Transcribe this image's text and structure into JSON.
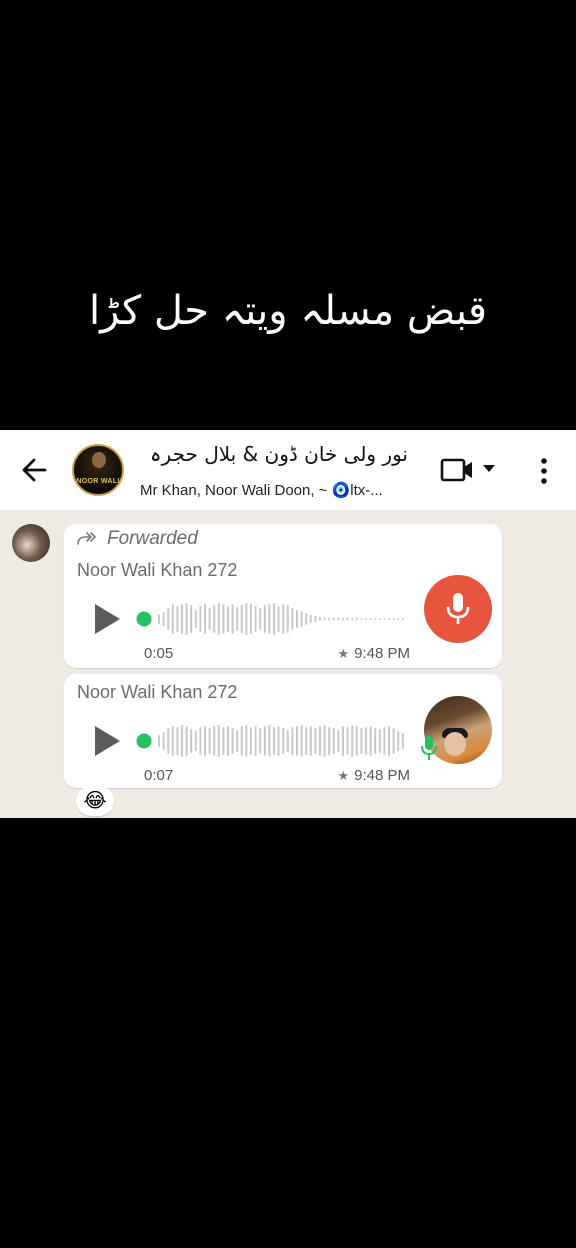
{
  "caption": "قبض مسلہ ویتہ حل کڑا",
  "header": {
    "title": "نور ولی خان ڈون & بلال حجرہ",
    "subtitle": "Mr Khan, Noor Wali Doon, ~ 🧿ltx-...",
    "avatar_text": "NOOR WALI"
  },
  "messages": [
    {
      "forwarded_label": "Forwarded",
      "sender": "Noor Wali Khan 272",
      "duration": "0:05",
      "time": "9:48 PM",
      "starred": true
    },
    {
      "sender": "Noor Wali Khan 272",
      "duration": "0:07",
      "time": "9:48 PM",
      "starred": true
    }
  ],
  "reaction": "😂",
  "colors": {
    "mic_button": "#e8553f",
    "playhead": "#25c160",
    "chat_background": "#efeae2"
  },
  "icons": [
    "back-arrow-icon",
    "video-call-icon",
    "more-vert-icon",
    "forward-icon",
    "play-icon",
    "mic-icon",
    "star-icon"
  ]
}
